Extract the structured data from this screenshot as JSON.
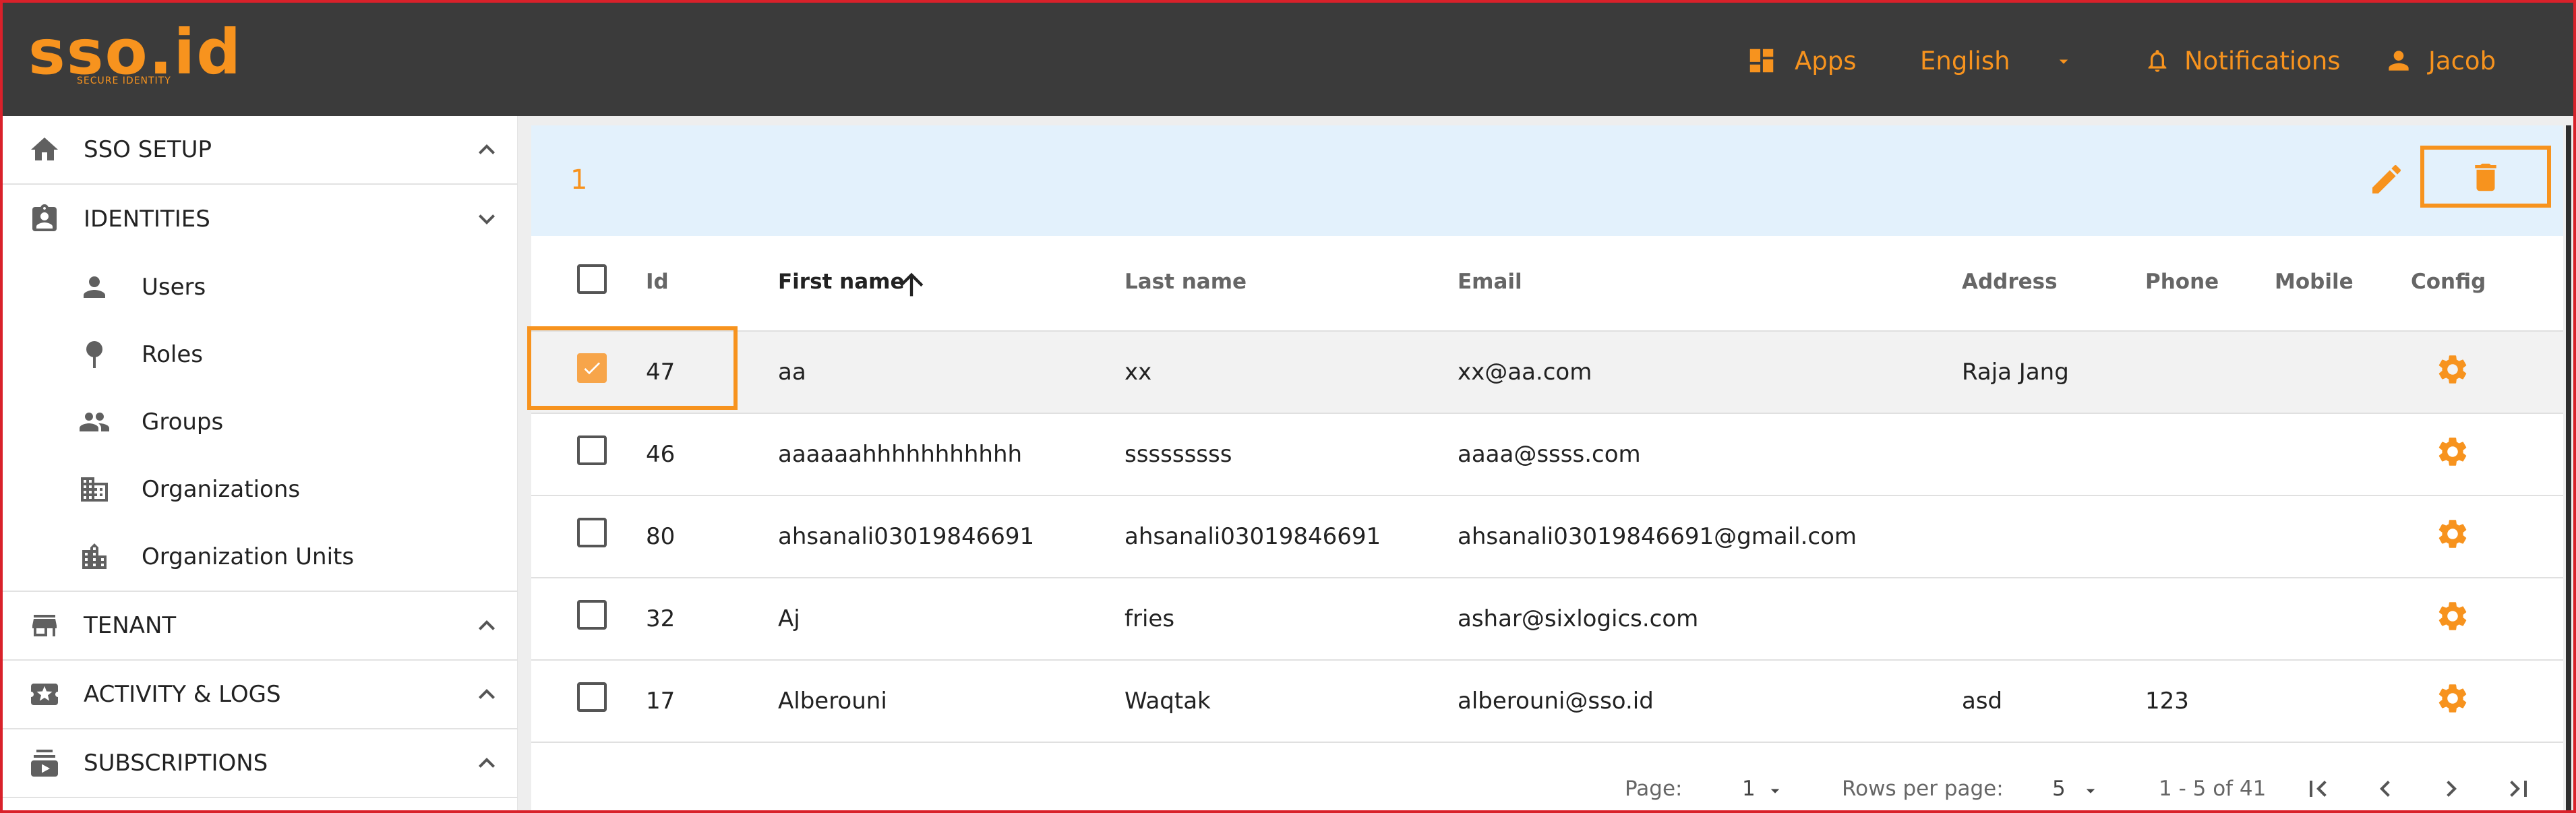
{
  "header": {
    "logo_text": "sso.id",
    "logo_subtitle": "SECURE IDENTITY",
    "apps_label": "Apps",
    "language": "English",
    "notifications_label": "Notifications",
    "user_name": "Jacob"
  },
  "sidebar": {
    "sections": [
      {
        "label": "SSO SETUP",
        "icon": "home-icon",
        "state": "collapsed"
      },
      {
        "label": "IDENTITIES",
        "icon": "badge-icon",
        "state": "expanded"
      },
      {
        "label": "TENANT",
        "icon": "store-icon",
        "state": "collapsed"
      },
      {
        "label": "ACTIVITY & LOGS",
        "icon": "ticket-icon",
        "state": "collapsed"
      },
      {
        "label": "SUBSCRIPTIONS",
        "icon": "subscriptions-icon",
        "state": "collapsed"
      }
    ],
    "identities_items": [
      {
        "label": "Users",
        "icon": "person-icon"
      },
      {
        "label": "Roles",
        "icon": "pin-icon"
      },
      {
        "label": "Groups",
        "icon": "people-icon"
      },
      {
        "label": "Organizations",
        "icon": "building-icon"
      },
      {
        "label": "Organization Units",
        "icon": "buildings-icon"
      }
    ]
  },
  "toolbar": {
    "selected_count": "1",
    "edit_icon": "pencil-icon",
    "delete_icon": "trash-icon"
  },
  "table": {
    "headers": {
      "id": "Id",
      "first_name": "First name",
      "last_name": "Last name",
      "email": "Email",
      "address": "Address",
      "phone": "Phone",
      "mobile": "Mobile",
      "config": "Config"
    },
    "sorted_by": "First name",
    "sort_direction": "ascending",
    "rows": [
      {
        "checked": true,
        "id": "47",
        "first_name": "aa",
        "last_name": "xx",
        "email": "xx@aa.com",
        "address": "Raja Jang",
        "phone": "",
        "mobile": ""
      },
      {
        "checked": false,
        "id": "46",
        "first_name": "aaaaaahhhhhhhhhhh",
        "last_name": "sssssssss",
        "email": "aaaa@ssss.com",
        "address": "",
        "phone": "",
        "mobile": ""
      },
      {
        "checked": false,
        "id": "80",
        "first_name": "ahsanali03019846691",
        "last_name": "ahsanali03019846691",
        "email": "ahsanali03019846691@gmail.com",
        "address": "",
        "phone": "",
        "mobile": ""
      },
      {
        "checked": false,
        "id": "32",
        "first_name": "Aj",
        "last_name": "fries",
        "email": "ashar@sixlogics.com",
        "address": "",
        "phone": "",
        "mobile": ""
      },
      {
        "checked": false,
        "id": "17",
        "first_name": "Alberouni",
        "last_name": "Waqtak",
        "email": "alberouni@sso.id",
        "address": "asd",
        "phone": "123",
        "mobile": ""
      }
    ]
  },
  "footer": {
    "page_label": "Page:",
    "page_value": "1",
    "rows_per_page_label": "Rows per page:",
    "rows_per_page_value": "5",
    "range_text": "1 - 5 of 41"
  },
  "colors": {
    "accent": "#f7931e",
    "header_bg": "#3b3b3b",
    "toolbar_bg": "#e3f1fc"
  }
}
